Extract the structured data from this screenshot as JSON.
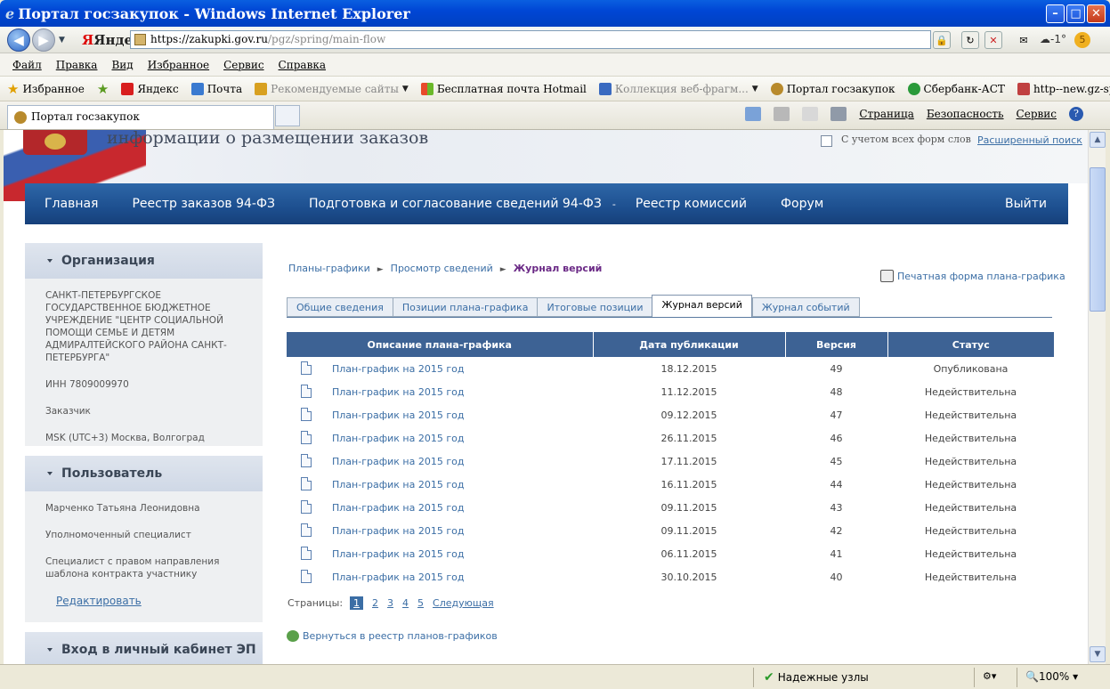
{
  "window": {
    "title": "Портал госзакупок - Windows Internet Explorer"
  },
  "address": {
    "yandex": "Яндекс",
    "url_host": "https://zakupki.gov.ru",
    "url_path": "/pgz/spring/main-flow",
    "weather": "-1°"
  },
  "menu": [
    "Файл",
    "Правка",
    "Вид",
    "Избранное",
    "Сервис",
    "Справка"
  ],
  "favorites": {
    "label": "Избранное",
    "items": [
      {
        "label": "Яндекс",
        "color": "#d81e1e",
        "dim": false
      },
      {
        "label": "Почта",
        "color": "#3a7ad0",
        "dim": false
      },
      {
        "label": "Рекомендуемые сайты",
        "color": "#d8a020",
        "dim": true
      },
      {
        "label": "Бесплатная почта Hotmail",
        "color": "#2b9ad8",
        "dim": false
      },
      {
        "label": "Коллекция веб-фрагм...",
        "color": "#3a6ac0",
        "dim": true
      },
      {
        "label": "Портал госзакупок",
        "color": "#b88a2c",
        "dim": false
      },
      {
        "label": "Сбербанк-АСТ",
        "color": "#2a9a3a",
        "dim": false
      },
      {
        "label": "http--new.gz-spb.ru-",
        "color": "#c04040",
        "dim": false
      }
    ]
  },
  "tab": {
    "label": "Портал госзакупок"
  },
  "commands": {
    "page": "Страница",
    "security": "Безопасность",
    "service": "Сервис"
  },
  "site": {
    "title_fragment": "информации о размещении заказов",
    "search_option": "С учетом всех форм слов",
    "advanced_search": "Расширенный поиск"
  },
  "nav": {
    "items": [
      "Главная",
      "Реестр заказов 94-ФЗ",
      "Подготовка и согласование сведений 94-ФЗ",
      "Реестр комиссий",
      "Форум"
    ],
    "dropdown_marker": "-",
    "logout": "Выйти"
  },
  "org": {
    "header": "Организация",
    "name": "САНКТ-ПЕТЕРБУРГСКОЕ ГОСУДАРСТВЕННОЕ БЮДЖЕТНОЕ УЧРЕЖДЕНИЕ \"ЦЕНТР СОЦИАЛЬНОЙ ПОМОЩИ СЕМЬЕ И ДЕТЯМ АДМИРАЛТЕЙСКОГО РАЙОНА САНКТ-ПЕТЕРБУРГА\"",
    "inn": "ИНН 7809009970",
    "role": "Заказчик",
    "timezone": "MSK (UTC+3) Москва, Волгоград"
  },
  "user": {
    "header": "Пользователь",
    "name": "Марченко Татьяна Леонидовна",
    "position": "Уполномоченный специалист",
    "rights": "Специалист с правом направления шаблона контракта участнику",
    "edit": "Редактировать"
  },
  "cabinet": {
    "header": "Вход в личный кабинет ЭП"
  },
  "breadcrumbs": {
    "items": [
      "Планы-графики",
      "Просмотр сведений"
    ],
    "current": "Журнал версий"
  },
  "print_link": "Печатная форма плана-графика",
  "tabs": [
    "Общие сведения",
    "Позиции плана-графика",
    "Итоговые позиции",
    "Журнал версий",
    "Журнал событий"
  ],
  "active_tab": "Журнал версий",
  "table": {
    "columns": [
      "Описание плана-графика",
      "Дата публикации",
      "Версия",
      "Статус"
    ],
    "rows": [
      {
        "desc": "План-график на 2015 год",
        "date": "18.12.2015",
        "version": "49",
        "status": "Опубликована"
      },
      {
        "desc": "План-график на 2015 год",
        "date": "11.12.2015",
        "version": "48",
        "status": "Недействительна"
      },
      {
        "desc": "План-график на 2015 год",
        "date": "09.12.2015",
        "version": "47",
        "status": "Недействительна"
      },
      {
        "desc": "План-график на 2015 год",
        "date": "26.11.2015",
        "version": "46",
        "status": "Недействительна"
      },
      {
        "desc": "План-график на 2015 год",
        "date": "17.11.2015",
        "version": "45",
        "status": "Недействительна"
      },
      {
        "desc": "План-график на 2015 год",
        "date": "16.11.2015",
        "version": "44",
        "status": "Недействительна"
      },
      {
        "desc": "План-график на 2015 год",
        "date": "09.11.2015",
        "version": "43",
        "status": "Недействительна"
      },
      {
        "desc": "План-график на 2015 год",
        "date": "09.11.2015",
        "version": "42",
        "status": "Недействительна"
      },
      {
        "desc": "План-график на 2015 год",
        "date": "06.11.2015",
        "version": "41",
        "status": "Недействительна"
      },
      {
        "desc": "План-график на 2015 год",
        "date": "30.10.2015",
        "version": "40",
        "status": "Недействительна"
      }
    ]
  },
  "pager": {
    "label": "Страницы:",
    "pages": [
      "1",
      "2",
      "3",
      "4",
      "5"
    ],
    "current": "1",
    "next": "Следующая"
  },
  "back_link": "Вернуться в реестр планов-графиков",
  "status": {
    "zone": "Надежные узлы",
    "zoom": "100%"
  },
  "colors": {
    "nav": "#1d4f8f",
    "table_header": "#3d6294",
    "link": "#3b6ea5",
    "breadcrumb_current": "#6b2a86"
  }
}
